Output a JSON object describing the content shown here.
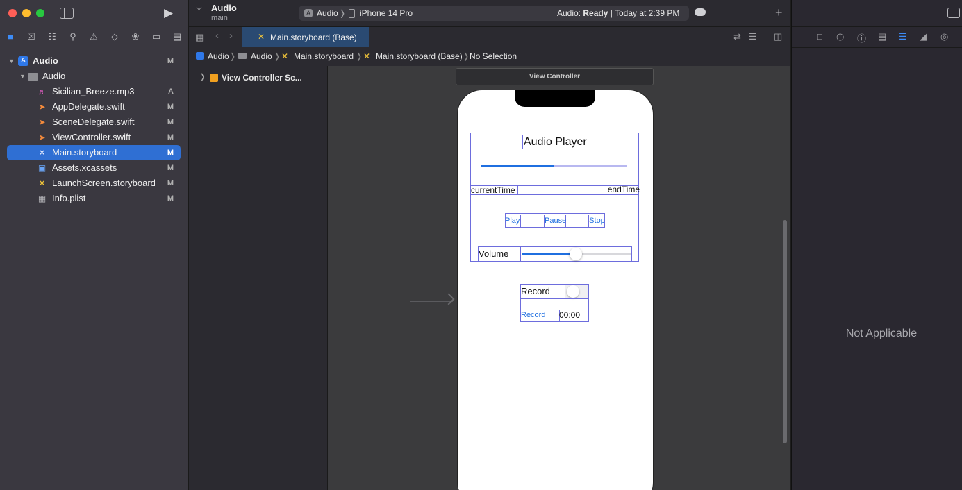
{
  "window": {
    "project_name": "Audio",
    "branch": "main"
  },
  "scheme": {
    "target": "Audio",
    "device": "iPhone 14 Pro",
    "status_prefix": "Audio: ",
    "status_state": "Ready",
    "status_time": "Today at 2:39 PM"
  },
  "navigator": {
    "items": [
      {
        "label": "Audio",
        "flag": "M"
      },
      {
        "label": "Audio",
        "flag": ""
      },
      {
        "label": "Sicilian_Breeze.mp3",
        "flag": "A"
      },
      {
        "label": "AppDelegate.swift",
        "flag": "M"
      },
      {
        "label": "SceneDelegate.swift",
        "flag": "M"
      },
      {
        "label": "ViewController.swift",
        "flag": "M"
      },
      {
        "label": "Main.storyboard",
        "flag": "M"
      },
      {
        "label": "Assets.xcassets",
        "flag": "M"
      },
      {
        "label": "LaunchScreen.storyboard",
        "flag": "M"
      },
      {
        "label": "Info.plist",
        "flag": "M"
      }
    ]
  },
  "editor": {
    "tab_label": "Main.storyboard (Base)",
    "breadcrumb": [
      "Audio",
      "Audio",
      "Main.storyboard",
      "Main.storyboard (Base)",
      "No Selection"
    ],
    "outline_item": "View Controller Sc...",
    "scene_title": "View Controller"
  },
  "storyboard": {
    "title": "Audio Player",
    "progress_value": 0.5,
    "current_time_label": "currentTime",
    "end_time_label": "endTime",
    "play_button": "Play",
    "pause_button": "Pause",
    "stop_button": "Stop",
    "volume_label": "Volume",
    "volume_value": 0.5,
    "record_label": "Record",
    "record_button": "Record",
    "record_time": "00:00"
  },
  "inspector": {
    "empty_message": "Not Applicable"
  },
  "colors": {
    "accent": "#2f6fd3",
    "selection": "#2f6fd3",
    "close": "#ff5f57",
    "minimize": "#febc2e",
    "zoom": "#28c840"
  }
}
